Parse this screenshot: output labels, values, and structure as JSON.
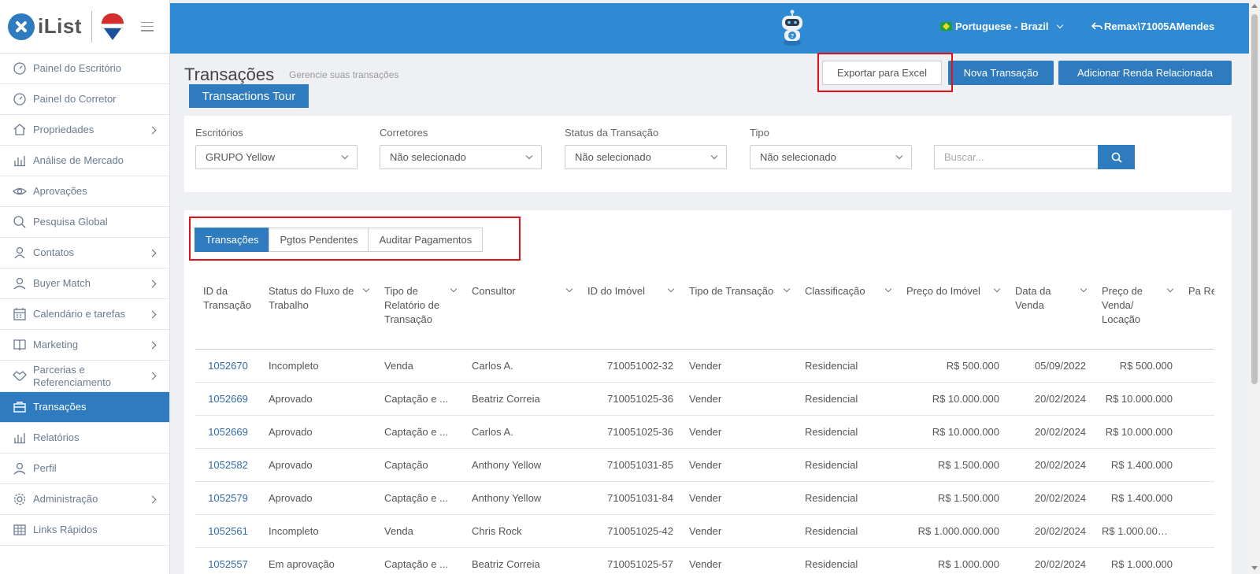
{
  "brand": {
    "name": "iList"
  },
  "sidebar": {
    "items": [
      {
        "label": "Painel do Escritório",
        "icon": "gauge-icon",
        "has_arrow": false
      },
      {
        "label": "Painel do Corretor",
        "icon": "gauge-icon",
        "has_arrow": false
      },
      {
        "label": "Propriedades",
        "icon": "home-icon",
        "has_arrow": true
      },
      {
        "label": "Análise de Mercado",
        "icon": "bar-chart-icon",
        "has_arrow": false
      },
      {
        "label": "Aprovações",
        "icon": "eye-icon",
        "has_arrow": false
      },
      {
        "label": "Pesquisa Global",
        "icon": "search-icon",
        "has_arrow": false
      },
      {
        "label": "Contatos",
        "icon": "contacts-icon",
        "has_arrow": true
      },
      {
        "label": "Buyer Match",
        "icon": "user-icon",
        "has_arrow": true
      },
      {
        "label": "Calendário e tarefas",
        "icon": "calendar-icon",
        "has_arrow": true
      },
      {
        "label": "Marketing",
        "icon": "book-icon",
        "has_arrow": true
      },
      {
        "label": "Parcerias e Referenciamento",
        "icon": "handshake-icon",
        "has_arrow": true
      },
      {
        "label": "Transações",
        "icon": "briefcase-icon",
        "has_arrow": false,
        "active": true
      },
      {
        "label": "Relatórios",
        "icon": "bar-chart-icon",
        "has_arrow": false
      },
      {
        "label": "Perfil",
        "icon": "user-icon",
        "has_arrow": false
      },
      {
        "label": "Administração",
        "icon": "gear-icon",
        "has_arrow": true
      },
      {
        "label": "Links Rápidos",
        "icon": "grid-icon",
        "has_arrow": false
      }
    ]
  },
  "topbar": {
    "language": "Portuguese - Brazil",
    "user": "Remax\\71005AMendes"
  },
  "header": {
    "title": "Transações",
    "subtitle": "Gerencie suas transações",
    "tour_button": "Transactions Tour",
    "export_button": "Exportar para Excel",
    "new_button": "Nova Transação",
    "add_income_button": "Adicionar Renda Relacionada"
  },
  "filters": {
    "office": {
      "label": "Escritórios",
      "value": "GRUPO Yellow"
    },
    "brokers": {
      "label": "Corretores",
      "value": "Não selecionado"
    },
    "status": {
      "label": "Status da Transação",
      "value": "Não selecionado"
    },
    "type": {
      "label": "Tipo",
      "value": "Não selecionado"
    },
    "search_placeholder": "Buscar..."
  },
  "tabs": [
    "Transações",
    "Pgtos Pendentes",
    "Auditar Pagamentos"
  ],
  "table": {
    "columns": [
      "ID da Transação",
      "Status do Fluxo de Trabalho",
      "Tipo de Relatório de Transação",
      "Consultor",
      "ID do Imóvel",
      "Tipo de Transação",
      "Classificação",
      "Preço do Imóvel",
      "Data da Venda",
      "Preço de Venda/ Locação",
      "Pa Re"
    ],
    "rows": [
      [
        "1052670",
        "Incompleto",
        "Venda",
        "Carlos A.",
        "710051002-32",
        "Vender",
        "Residencial",
        "R$ 500.000",
        "05/09/2022",
        "R$ 500.000",
        ""
      ],
      [
        "1052669",
        "Aprovado",
        "Captação e ...",
        "Beatriz Correia",
        "710051025-36",
        "Vender",
        "Residencial",
        "R$ 10.000.000",
        "20/02/2024",
        "R$ 10.000.000",
        ""
      ],
      [
        "1052669",
        "Aprovado",
        "Captação e ...",
        "Carlos A.",
        "710051025-36",
        "Vender",
        "Residencial",
        "R$ 10.000.000",
        "20/02/2024",
        "R$ 10.000.000",
        ""
      ],
      [
        "1052582",
        "Aprovado",
        "Captação",
        "Anthony Yellow",
        "710051031-85",
        "Vender",
        "Residencial",
        "R$ 1.500.000",
        "20/02/2024",
        "R$ 1.400.000",
        ""
      ],
      [
        "1052579",
        "Aprovado",
        "Captação e ...",
        "Anthony Yellow",
        "710051031-84",
        "Vender",
        "Residencial",
        "R$ 1.500.000",
        "20/02/2024",
        "R$ 1.400.000",
        ""
      ],
      [
        "1052561",
        "Incompleto",
        "Venda",
        "Chris Rock",
        "710051025-42",
        "Vender",
        "Residencial",
        "R$ 1.000.000.000",
        "20/02/2024",
        "R$ 1.000.000.0...",
        ""
      ],
      [
        "1052557",
        "Em aprovação",
        "Captação e ...",
        "Beatriz Correia",
        "710051025-57",
        "Vender",
        "Residencial",
        "R$ 1.000.000",
        "20/02/2024",
        "R$ 1.000.000",
        ""
      ]
    ]
  },
  "colors": {
    "primary": "#2f7bbf",
    "topbar": "#3089d3",
    "highlight": "#e3101a"
  }
}
